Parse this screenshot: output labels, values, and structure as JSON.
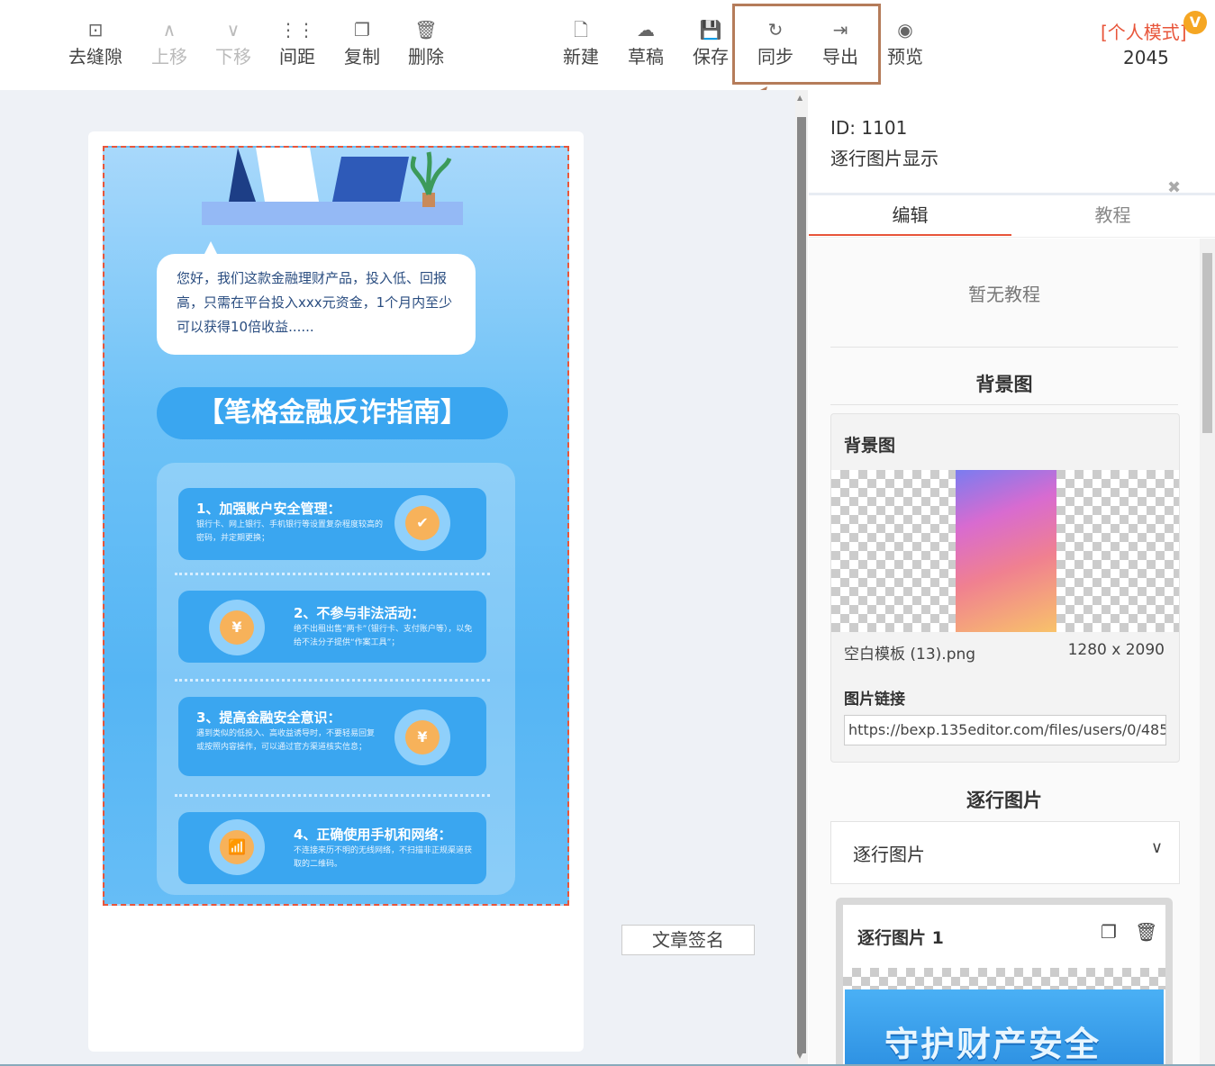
{
  "toolbar": {
    "items": [
      {
        "label": "去缝隙",
        "icon": "⊡"
      },
      {
        "label": "上移",
        "icon": "∧"
      },
      {
        "label": "下移",
        "icon": "∨"
      },
      {
        "label": "间距",
        "icon": "⋮⋮"
      },
      {
        "label": "复制",
        "icon": "❐"
      },
      {
        "label": "删除",
        "icon": "🗑"
      },
      {
        "label": "新建",
        "icon": "🗋"
      },
      {
        "label": "草稿",
        "icon": "☁"
      },
      {
        "label": "保存",
        "icon": "💾"
      },
      {
        "label": "同步",
        "icon": "↻"
      },
      {
        "label": "导出",
        "icon": "⇥"
      },
      {
        "label": "预览",
        "icon": "◉"
      }
    ],
    "mode_label": "[个人模式]",
    "mode_badge": "V",
    "mode_number": "2045"
  },
  "poster": {
    "bubble_text": "您好，我们这款金融理财产品，投入低、回报高，只需在平台投入xxx元资金，1个月内至少可以获得10倍收益......",
    "title": "【笔格金融反诈指南】",
    "cards": [
      {
        "title": "1、加强账户安全管理：",
        "desc": "银行卡、网上银行、手机银行等设置复杂程度较高的密码，并定期更换；",
        "icon": "✔"
      },
      {
        "title": "2、不参与非法活动：",
        "desc": "绝不出租出售“两卡”（银行卡、支付账户等），以免给不法分子提供“作案工具”；",
        "icon": "¥"
      },
      {
        "title": "3、提高金融安全意识：",
        "desc": "遇到类似的低投入、高收益诱导时，不要轻易回复或按照内容操作，可以通过官方渠道核实信息；",
        "icon": "¥"
      },
      {
        "title": "4、正确使用手机和网络：",
        "desc": "不连接来历不明的无线网络，不扫描非正规渠道获取的二维码。",
        "icon": "📶"
      }
    ],
    "signature_button": "文章签名"
  },
  "sidebar": {
    "id_line": "ID: 1101",
    "name": "逐行图片显示",
    "tabs": [
      "编辑",
      "教程"
    ],
    "no_tutorial": "暂无教程",
    "bg_section_title": "背景图",
    "bg_box_title": "背景图",
    "file_name": "空白模板 (13).png",
    "file_size": "1280 x 2090",
    "link_label": "图片链接",
    "link_value": "https://bexp.135editor.com/files/users/0/485...",
    "rows_section_title": "逐行图片",
    "rows_select_value": "逐行图片",
    "item_title": "逐行图片 1",
    "thumb_text": "守护财产安全"
  },
  "colors": {
    "accent": "#e8553a",
    "highlight_box": "#b57c5a",
    "poster_blue": "#3aa6f0"
  }
}
